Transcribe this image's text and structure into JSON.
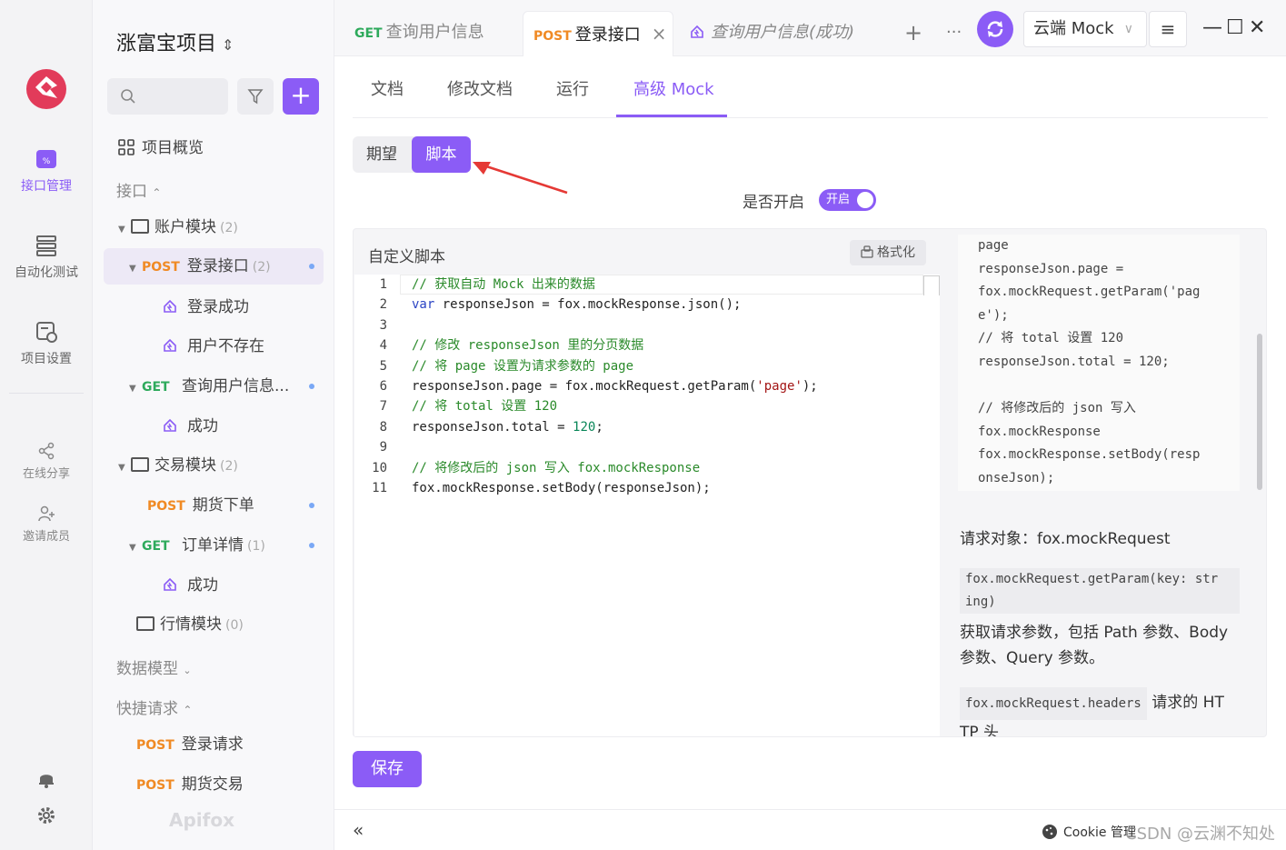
{
  "rail": {
    "items": [
      {
        "label": "接口管理",
        "active": true
      },
      {
        "label": "自动化测试",
        "active": false
      },
      {
        "label": "项目设置",
        "active": false
      }
    ],
    "small_items": [
      {
        "label": "在线分享"
      },
      {
        "label": "邀请成员"
      }
    ]
  },
  "sidebar": {
    "project_title": "涨富宝项目",
    "overview": "项目概览",
    "section_api": "接口",
    "tree": [
      {
        "type": "folder",
        "label": "账户模块",
        "count": "(2)"
      },
      {
        "type": "api",
        "method": "POST",
        "label": "登录接口",
        "count": "(2)",
        "selected": true
      },
      {
        "type": "case",
        "label": "登录成功"
      },
      {
        "type": "case",
        "label": "用户不存在"
      },
      {
        "type": "api",
        "method": "GET",
        "label": "查询用户信息...",
        "count": ""
      },
      {
        "type": "case",
        "label": "成功"
      },
      {
        "type": "folder",
        "label": "交易模块",
        "count": "(2)"
      },
      {
        "type": "api",
        "method": "POST",
        "label": "期货下单",
        "count": ""
      },
      {
        "type": "api",
        "method": "GET",
        "label": "订单详情",
        "count": "(1)"
      },
      {
        "type": "case",
        "label": "成功"
      },
      {
        "type": "folder",
        "label": "行情模块",
        "count": "(0)"
      }
    ],
    "section_models": "数据模型",
    "section_quick": "快捷请求",
    "quick": [
      {
        "method": "POST",
        "label": "登录请求"
      },
      {
        "method": "POST",
        "label": "期货交易"
      }
    ],
    "brand": "Apifox"
  },
  "tabs": [
    {
      "method": "GET",
      "label": "查询用户信息",
      "active": false
    },
    {
      "method": "POST",
      "label": "登录接口",
      "active": true
    },
    {
      "method": "",
      "label": "查询用户信息(成功)",
      "active": false
    }
  ],
  "env": {
    "selected": "云端 Mock"
  },
  "subtabs": [
    "文档",
    "修改文档",
    "运行",
    "高级 Mock"
  ],
  "mock": {
    "seg_expect": "期望",
    "seg_script": "脚本",
    "toggle_label": "是否开启",
    "toggle_value": "开启",
    "panel_title": "自定义脚本",
    "format_button": "格式化",
    "save_button": "保存"
  },
  "code_lines": [
    {
      "n": "1",
      "text": "// 获取自动 Mock 出来的数据"
    },
    {
      "n": "2",
      "text": "var responseJson = fox.mockResponse.json();"
    },
    {
      "n": "3",
      "text": ""
    },
    {
      "n": "4",
      "text": "// 修改 responseJson 里的分页数据"
    },
    {
      "n": "5",
      "text": "// 将 page 设置为请求参数的 page"
    },
    {
      "n": "6",
      "text": "responseJson.page = fox.mockRequest.getParam('page');"
    },
    {
      "n": "7",
      "text": "// 将 total 设置 120"
    },
    {
      "n": "8",
      "text": "responseJson.total = 120;"
    },
    {
      "n": "9",
      "text": ""
    },
    {
      "n": "10",
      "text": "// 将修改后的 json 写入 fox.mockResponse"
    },
    {
      "n": "11",
      "text": "fox.mockResponse.setBody(responseJson);"
    }
  ],
  "docs": {
    "code_block": [
      "page",
      "responseJson.page =",
      "fox.mockRequest.getParam('pag",
      "e');",
      "// 将 total 设置 120",
      "responseJson.total = 120;",
      "",
      "// 将修改后的 json 写入",
      "fox.mockResponse",
      "fox.mockResponse.setBody(resp",
      "onseJson);"
    ],
    "request_heading": "请求对象：fox.mockRequest",
    "getparam_code_1": "fox.mockRequest.getParam(key: str",
    "getparam_code_2": "ing)",
    "getparam_desc": "获取请求参数，包括 Path 参数、Body 参数、Query 参数。",
    "headers_code": "fox.mockRequest.headers",
    "headers_desc_1": "请求的 HT",
    "headers_desc_2": "TP 头"
  },
  "footer": {
    "cookie": "Cookie 管理",
    "watermark": "CSDN @云渊不知处"
  }
}
